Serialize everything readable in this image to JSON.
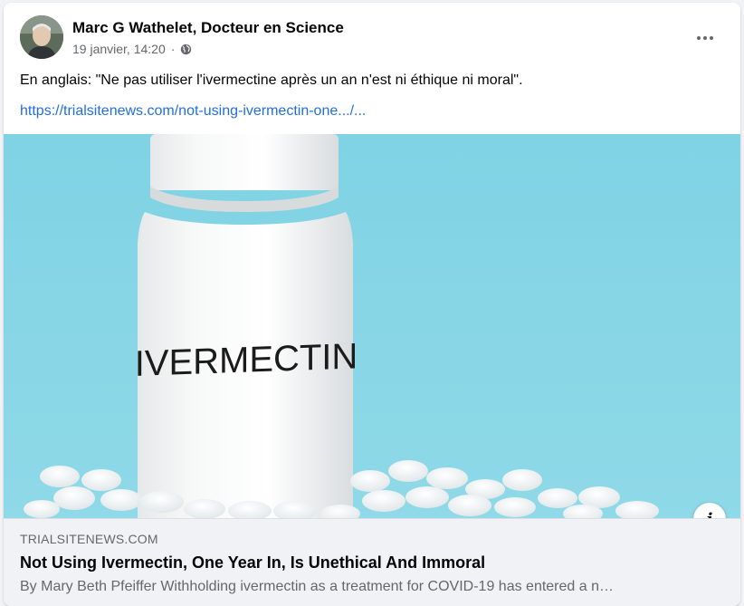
{
  "post": {
    "author": "Marc G Wathelet, Docteur en Science",
    "timestamp": "19 janvier, 14:20",
    "audience_icon": "globe-icon",
    "more_icon": "more-options-icon",
    "text": "En anglais: \"Ne pas utiliser l'ivermectine après un an n'est ni éthique ni moral\".",
    "link_text": "https://trialsitenews.com/not-using-ivermectin-one.../..."
  },
  "image": {
    "bottle_label": "IVERMECTIN",
    "background_color": "#7ed3e4"
  },
  "link_preview": {
    "domain": "TRIALSITENEWS.COM",
    "title": "Not Using Ivermectin, One Year In, Is Unethical And Immoral",
    "description": "By Mary Beth Pfeiffer Withholding ivermectin as a treatment for COVID-19 has entered a n…",
    "info_icon": "info-icon",
    "info_label": "i"
  },
  "colors": {
    "link": "#216fdb",
    "secondary_text": "#65676b",
    "preview_bg": "#f0f2f5"
  }
}
